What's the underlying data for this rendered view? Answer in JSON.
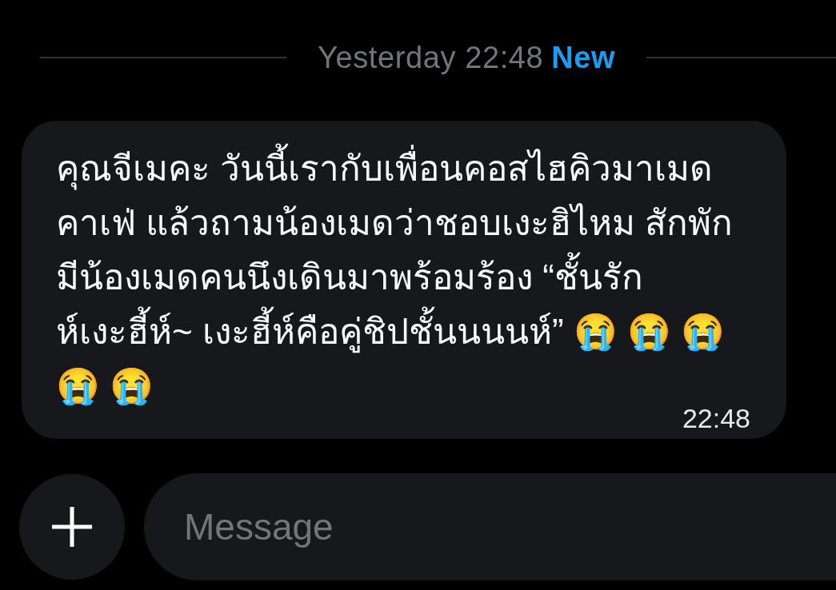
{
  "date_divider": {
    "label": "Yesterday 22:48",
    "badge": "New"
  },
  "messages": [
    {
      "text": "คุณจีเมคะ วันนี้เรากับเพื่อนคอสไฮคิวมาเมดคาเฟ่ แล้วถามน้องเมดว่าชอบเงะฮิไหม สักพักมีน้องเมดคนนึงเดินมาพร้อมร้อง “ชั้นรักห์เงะฮี้ห์~ เงะฮี้ห์คือคู่ชิปชั้นนนนห์” 😭 😭 😭 😭 😭",
      "time": "22:48"
    }
  ],
  "composer": {
    "placeholder": "Message"
  }
}
